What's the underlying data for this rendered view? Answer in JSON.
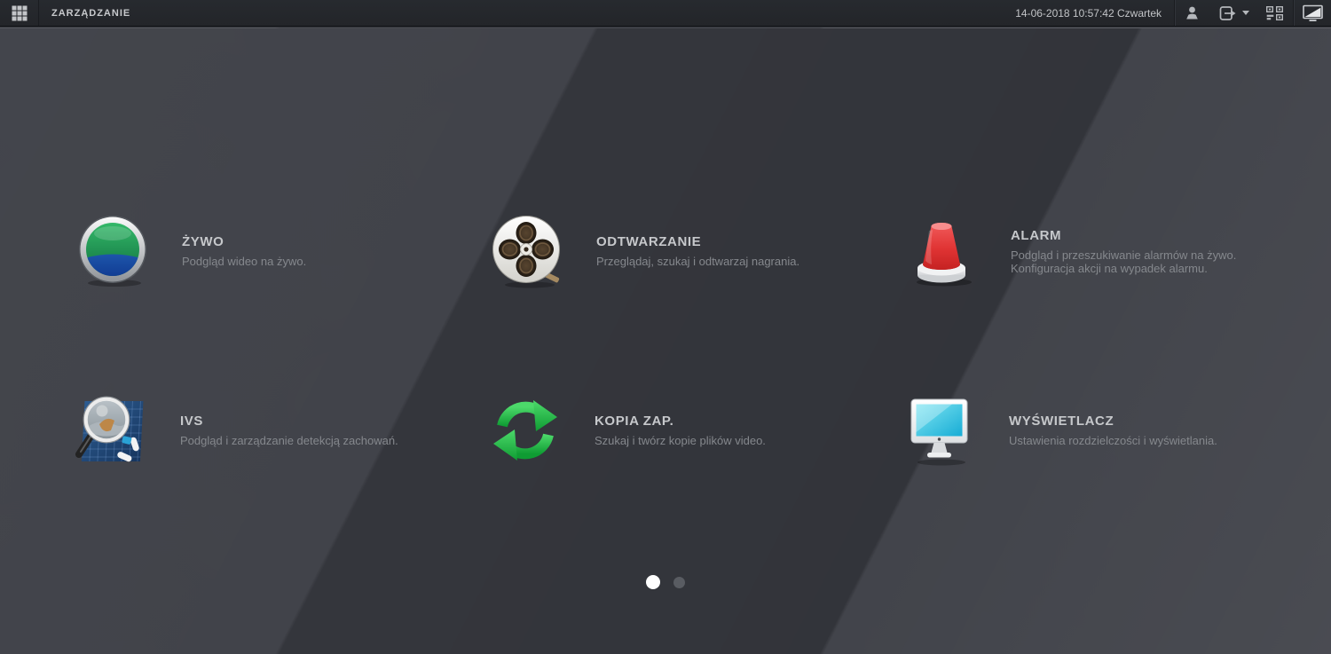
{
  "topbar": {
    "title": "ZARZĄDZANIE",
    "datetime": "14-06-2018 10:57:42 Czwartek",
    "icons": {
      "apps_grid": "apps-grid-icon",
      "user": "user-icon",
      "logout": "logout-icon",
      "dropdown_caret": "chevron-down-icon",
      "qr_code": "qr-code-icon",
      "screen_split": "screen-split-icon"
    }
  },
  "menu": {
    "items": [
      {
        "icon": "live-view-icon",
        "title": "ŻYWO",
        "desc1": "Podgląd wideo na żywo.",
        "desc2": ""
      },
      {
        "icon": "playback-icon",
        "title": "ODTWARZANIE",
        "desc1": "Przeglądaj, szukaj i odtwarzaj nagrania.",
        "desc2": ""
      },
      {
        "icon": "alarm-icon",
        "title": "ALARM",
        "desc1": "Podgląd i przeszukiwanie alarmów na żywo.",
        "desc2": "Konfiguracja akcji na wypadek alarmu."
      },
      {
        "icon": "ivs-icon",
        "title": "IVS",
        "desc1": "Podgląd i zarządzanie detekcją zachowań.",
        "desc2": ""
      },
      {
        "icon": "backup-icon",
        "title": "KOPIA ZAP.",
        "desc1": "Szukaj i twórz kopie plików video.",
        "desc2": ""
      },
      {
        "icon": "display-icon",
        "title": "WYŚWIETLACZ",
        "desc1": "Ustawienia rozdzielczości i wyświetlania.",
        "desc2": ""
      }
    ]
  },
  "pagination": {
    "total_pages": 2,
    "active_index": 0
  },
  "colors": {
    "topbar_bg": "#25282c",
    "background_light": "#3d3f46",
    "background_dark_band": "#323439",
    "title_text": "#c6c8cb",
    "desc_text": "#85888d",
    "alarm_red": "#dd3131",
    "backup_green": "#27b94a",
    "display_cyan": "#3cc8e4",
    "live_green": "#26a35c",
    "live_blue": "#0d3b96",
    "active_dot": "#ffffff",
    "inactive_dot": "#595c62"
  }
}
